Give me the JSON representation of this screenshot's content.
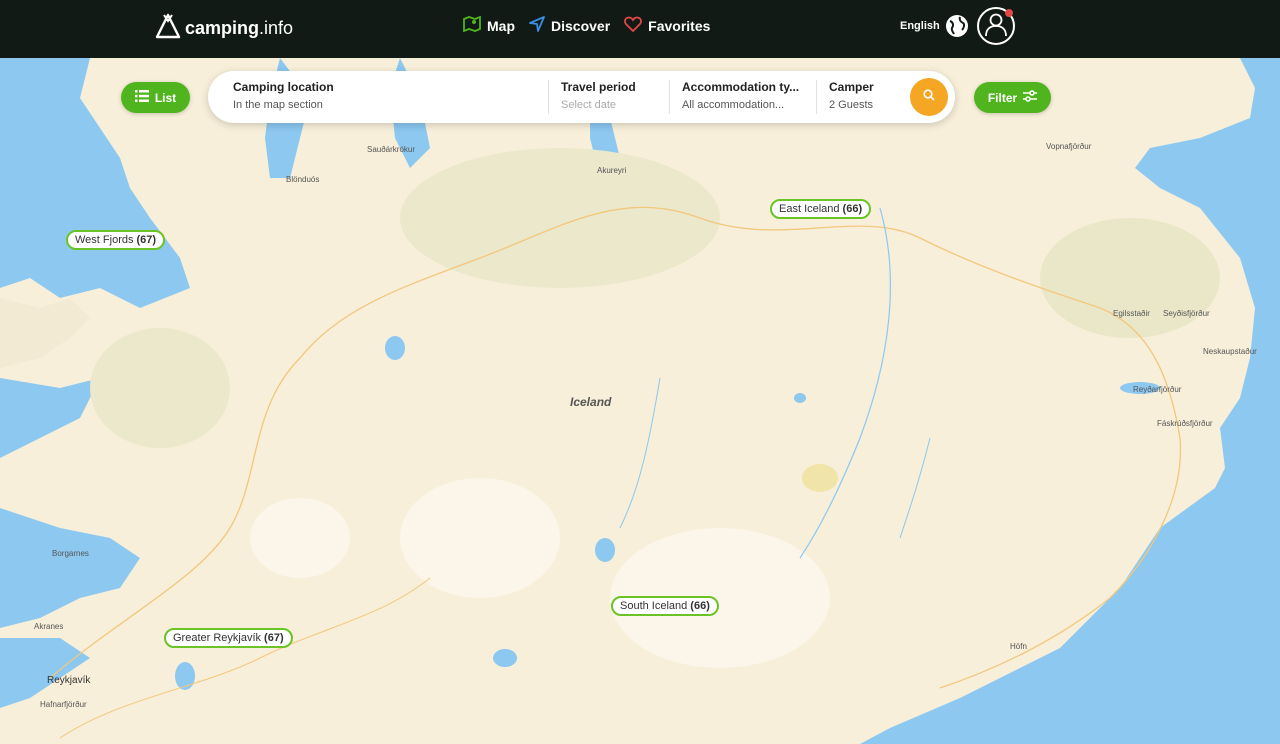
{
  "header": {
    "logo": {
      "name": "camping",
      "tld": ".info"
    },
    "nav": [
      {
        "label": "Map",
        "icon": "map-icon",
        "color": "#4fb41e"
      },
      {
        "label": "Discover",
        "icon": "navigation-arrow-icon",
        "color": "#3a8ee6"
      },
      {
        "label": "Favorites",
        "icon": "heart-icon",
        "color": "#e24747"
      }
    ],
    "language": "English"
  },
  "controls": {
    "list_label": "List",
    "filter_label": "Filter"
  },
  "search": {
    "location": {
      "label": "Camping location",
      "value": "In the map section"
    },
    "period": {
      "label": "Travel period",
      "placeholder": "Select date"
    },
    "accommodation": {
      "label": "Accommodation ty...",
      "value": "All accommodation..."
    },
    "camper": {
      "label": "Camper",
      "value": "2 Guests"
    }
  },
  "regions": [
    {
      "name": "West Fjords",
      "count": "67"
    },
    {
      "name": "East Iceland",
      "count": "66"
    },
    {
      "name": "South Iceland",
      "count": "66"
    },
    {
      "name": "Greater Reykjavík",
      "count": "67"
    }
  ],
  "places": {
    "country": "Iceland",
    "saudarkrokur": "Sauðárkrókur",
    "blonduos": "Blönduós",
    "akureyri": "Akureyri",
    "vopnafjordur": "Vopnafjörður",
    "egilsstadir": "Egilsstaðir",
    "seydisfjordur": "Seyðisfjörður",
    "neskaupstadur": "Neskaupstaður",
    "reydarfjordur": "Reyðarfjörður",
    "faskrudsfjordur": "Fáskrúðsfjörður",
    "borgarnes": "Borgarnes",
    "akranes": "Akranes",
    "reykjavik": "Reykjavík",
    "hafnarfjordur": "Hafnarfjörður",
    "hofn": "Höfn"
  },
  "colors": {
    "header_bg": "#121a15",
    "accent_green": "#4fb41e",
    "search_orange": "#f5a623",
    "water": "#8cc8f0",
    "land": "#f7efd9"
  }
}
